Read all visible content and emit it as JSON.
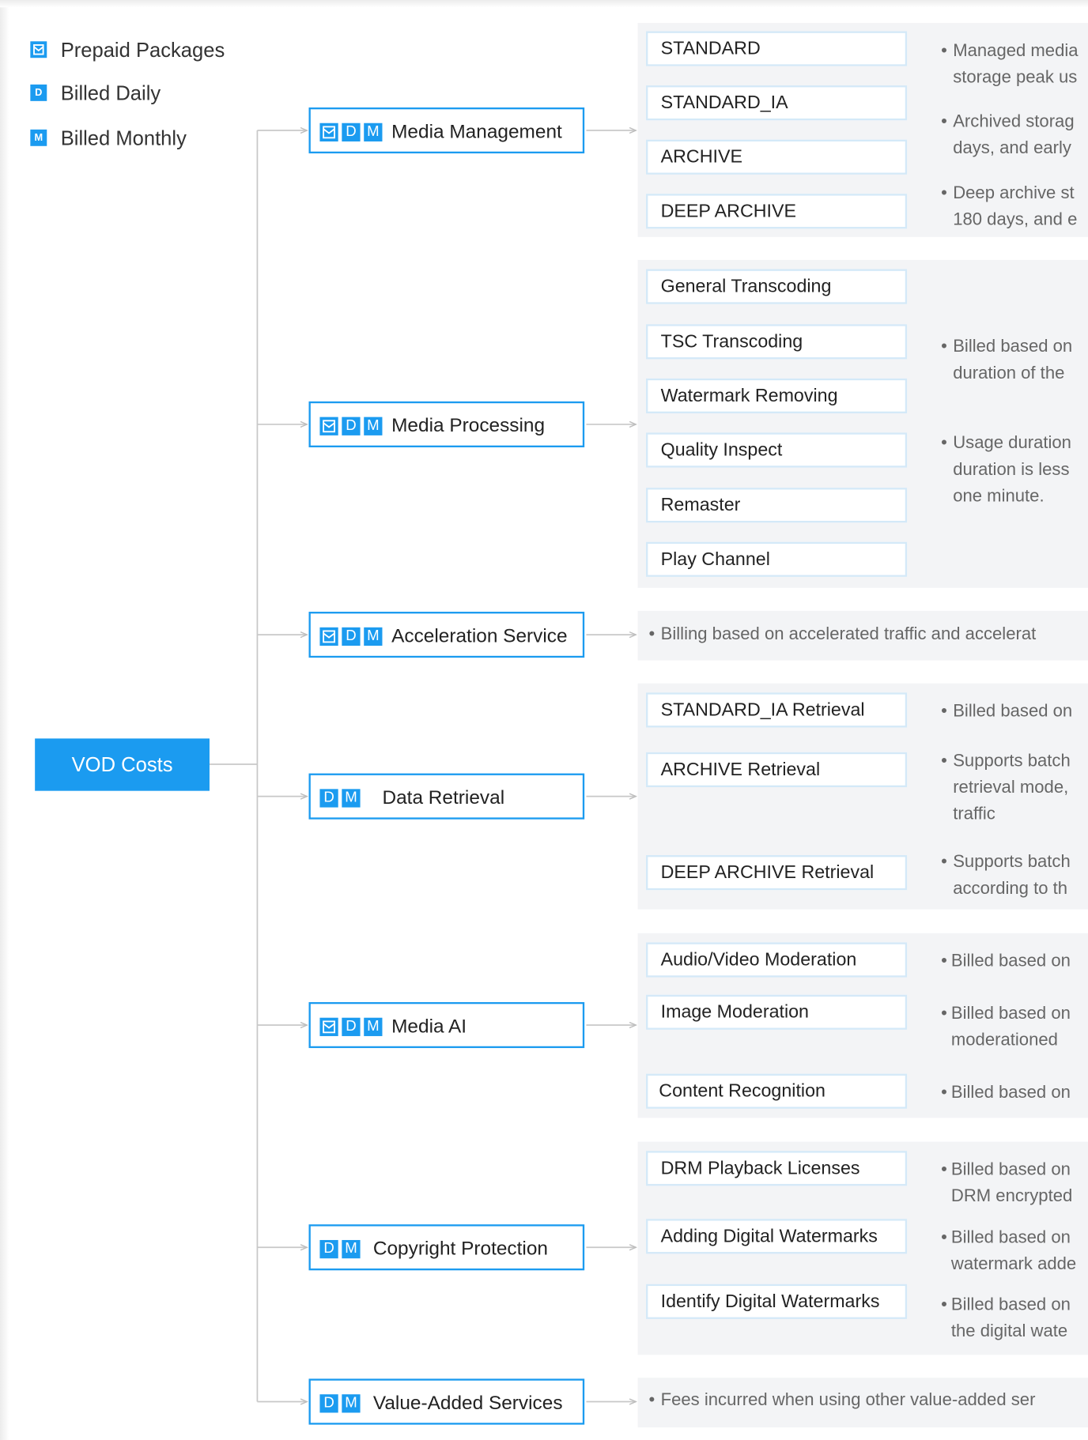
{
  "legend": [
    {
      "glyph": "prepaid",
      "label": "Prepaid Packages"
    },
    {
      "glyph": "D",
      "label": "Billed Daily"
    },
    {
      "glyph": "M",
      "label": "Billed Monthly"
    }
  ],
  "root": {
    "label": "VOD Costs"
  },
  "badge_letters": {
    "d": "D",
    "m": "M"
  },
  "categories": {
    "media_management": {
      "label": "Media Management",
      "badges": [
        "prepaid",
        "D",
        "M"
      ]
    },
    "media_processing": {
      "label": "Media Processing",
      "badges": [
        "prepaid",
        "D",
        "M"
      ]
    },
    "acceleration": {
      "label": "Acceleration Service",
      "badges": [
        "prepaid",
        "D",
        "M"
      ]
    },
    "data_retrieval": {
      "label": "Data Retrieval",
      "badges": [
        "D",
        "M"
      ]
    },
    "media_ai": {
      "label": "Media AI",
      "badges": [
        "prepaid",
        "D",
        "M"
      ]
    },
    "copyright": {
      "label": "Copyright Protection",
      "badges": [
        "D",
        "M"
      ]
    },
    "value_added": {
      "label": "Value-Added Services",
      "badges": [
        "D",
        "M"
      ]
    }
  },
  "items": {
    "standard": "STANDARD",
    "standard_ia": "STANDARD_IA",
    "archive": "ARCHIVE",
    "deep_archive": "DEEP ARCHIVE",
    "general_transcoding": "General Transcoding",
    "tsc_transcoding": "TSC Transcoding",
    "watermark_removing": "Watermark Removing",
    "quality_inspect": "Quality Inspect",
    "remaster": "Remaster",
    "play_channel": "Play Channel",
    "standard_ia_retrieval": "STANDARD_IA Retrieval",
    "archive_retrieval": "ARCHIVE Retrieval",
    "deep_archive_retrieval": "DEEP ARCHIVE Retrieval",
    "av_moderation": "Audio/Video Moderation",
    "image_moderation": "Image Moderation",
    "content_recognition": "Content Recognition",
    "drm_licenses": "DRM Playback Licenses",
    "adding_watermarks": "Adding Digital Watermarks",
    "identify_watermarks": "Identify Digital Watermarks"
  },
  "descriptions": {
    "mm_1a": "Managed media",
    "mm_1b": "storage peak us",
    "mm_2a": "Archived storag",
    "mm_2b": "days, and early",
    "mm_3a": "Deep archive st",
    "mm_3b": "180 days, and e",
    "mp_1a": "Billed based on",
    "mp_1b": "duration of the",
    "mp_2a": "Usage duration",
    "mp_2b": "duration is less",
    "mp_2c": "one minute.",
    "acc": "Billing based on accelerated traffic and accelerat",
    "dr_1": "Billed based on",
    "dr_2a": "Supports batch",
    "dr_2b": "retrieval mode,",
    "dr_2c": "traffic",
    "dr_3a": "Supports batch",
    "dr_3b": "according to th",
    "ai_1": "Billed based on",
    "ai_2a": "Billed based on",
    "ai_2b": "moderationed",
    "ai_3": "Billed based on",
    "cp_1a": "Billed based on",
    "cp_1b": "DRM encrypted",
    "cp_2a": "Billed based on",
    "cp_2b": "watermark adde",
    "cp_3a": "Billed based on",
    "cp_3b": "the digital wate",
    "va": "Fees incurred when using other value-added ser"
  },
  "colors": {
    "accent": "#1b9bf0",
    "line": "#c8c8c8",
    "panel": "#f3f4f6",
    "item_border": "#d4e9f8",
    "text": "#222222",
    "muted": "#666666"
  },
  "bullet": "•"
}
